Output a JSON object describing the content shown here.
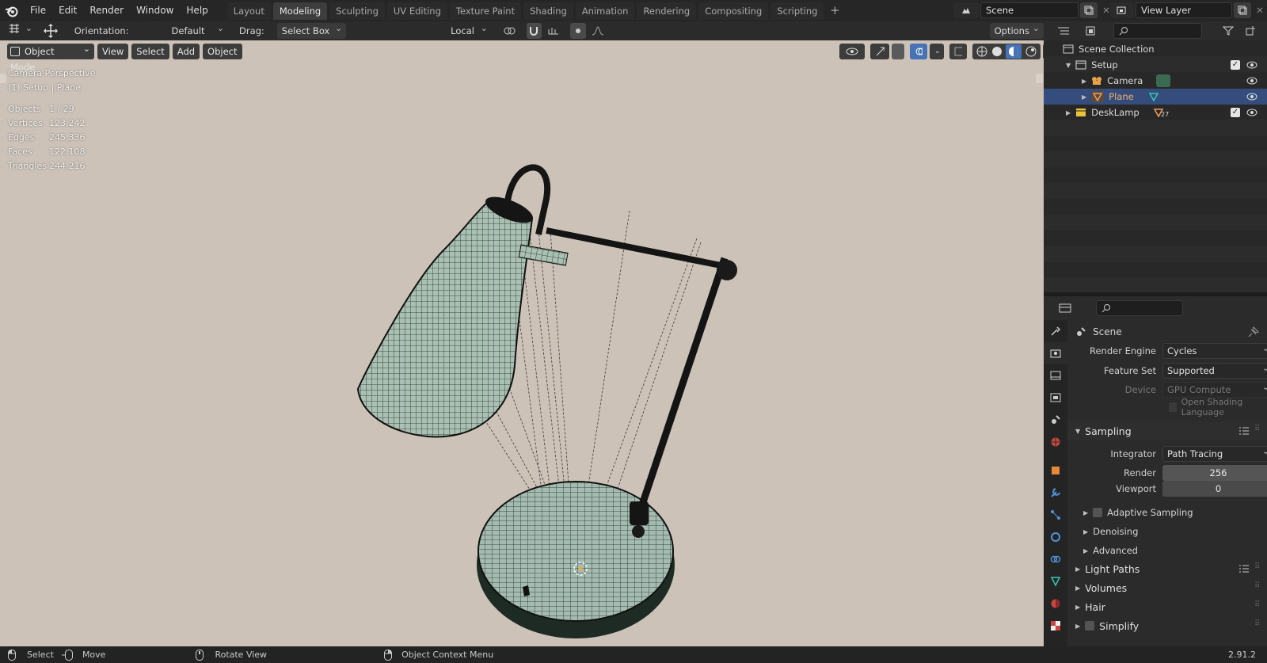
{
  "menu": {
    "items": [
      "File",
      "Edit",
      "Render",
      "Window",
      "Help"
    ]
  },
  "workspaces": {
    "tabs": [
      "Layout",
      "Modeling",
      "Sculpting",
      "UV Editing",
      "Texture Paint",
      "Shading",
      "Animation",
      "Rendering",
      "Compositing",
      "Scripting"
    ],
    "active": "Modeling"
  },
  "scene": {
    "name": "Scene"
  },
  "view_layer": {
    "name": "View Layer"
  },
  "header": {
    "orientation_label": "Orientation:",
    "orientation_value": "Default",
    "drag_label": "Drag:",
    "drag_value": "Select Box",
    "transform_space": "Local",
    "options_label": "Options"
  },
  "viewport": {
    "mode": "Object Mode",
    "menus": [
      "View",
      "Select",
      "Add",
      "Object"
    ],
    "overlay_title": "Camera Perspective",
    "overlay_subtitle": "(1) Setup | Plane",
    "stats": [
      {
        "label": "Objects",
        "value": "1 / 29"
      },
      {
        "label": "Vertices",
        "value": "123,242"
      },
      {
        "label": "Edges",
        "value": "245,336"
      },
      {
        "label": "Faces",
        "value": "122,108"
      },
      {
        "label": "Triangles",
        "value": "244,216"
      }
    ]
  },
  "outliner": {
    "root": "Scene Collection",
    "items": [
      {
        "name": "Setup",
        "type": "collection"
      },
      {
        "name": "Camera",
        "type": "camera"
      },
      {
        "name": "Plane",
        "type": "mesh",
        "selected": true
      },
      {
        "name": "DeskLamp",
        "type": "collection",
        "badge": "27"
      }
    ]
  },
  "properties": {
    "context": "Scene",
    "render_engine": {
      "label": "Render Engine",
      "value": "Cycles"
    },
    "feature_set": {
      "label": "Feature Set",
      "value": "Supported"
    },
    "device": {
      "label": "Device",
      "value": "GPU Compute"
    },
    "osl": {
      "label": "Open Shading Language"
    },
    "sampling": {
      "title": "Sampling",
      "integrator": {
        "label": "Integrator",
        "value": "Path Tracing"
      },
      "render": {
        "label": "Render",
        "value": "256"
      },
      "viewport": {
        "label": "Viewport",
        "value": "0"
      },
      "subsections": [
        "Adaptive Sampling",
        "Denoising",
        "Advanced"
      ]
    },
    "sections": [
      "Light Paths",
      "Volumes",
      "Hair",
      "Simplify"
    ]
  },
  "status": {
    "select": "Select",
    "move": "Move",
    "rotate": "Rotate View",
    "context_menu": "Object Context Menu",
    "version": "2.91.2"
  },
  "colors": {
    "accent": "#4772b3",
    "selected_row": "#344d7c",
    "viewport_bg": "#cdc2b7",
    "mesh_fill": "#a7bdb1"
  }
}
